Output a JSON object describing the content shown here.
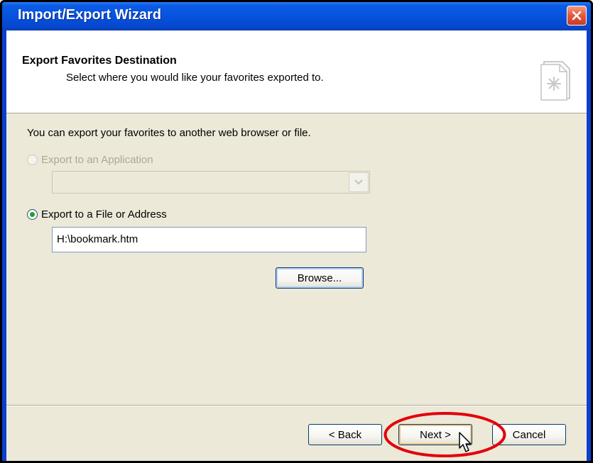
{
  "window": {
    "title": "Import/Export Wizard"
  },
  "header": {
    "title": "Export Favorites Destination",
    "subtitle": "Select where you would like your favorites exported to."
  },
  "body": {
    "intro": "You can export your favorites to another web browser or file.",
    "option_application": {
      "label": "Export to an Application",
      "checked": false,
      "disabled": true
    },
    "application_select": {
      "value": ""
    },
    "option_file": {
      "label": "Export to a File or Address",
      "checked": true
    },
    "file_path": "H:\\bookmark.htm",
    "browse_label": "Browse..."
  },
  "footer": {
    "back_label": "< Back",
    "next_label": "Next >",
    "cancel_label": "Cancel"
  },
  "colors": {
    "titlebar": "#0752dd",
    "background": "#ece9d8",
    "highlight": "#e3000b"
  },
  "icons": [
    "close-icon",
    "favorites-page-icon",
    "chevron-down-icon",
    "mouse-pointer-icon"
  ]
}
